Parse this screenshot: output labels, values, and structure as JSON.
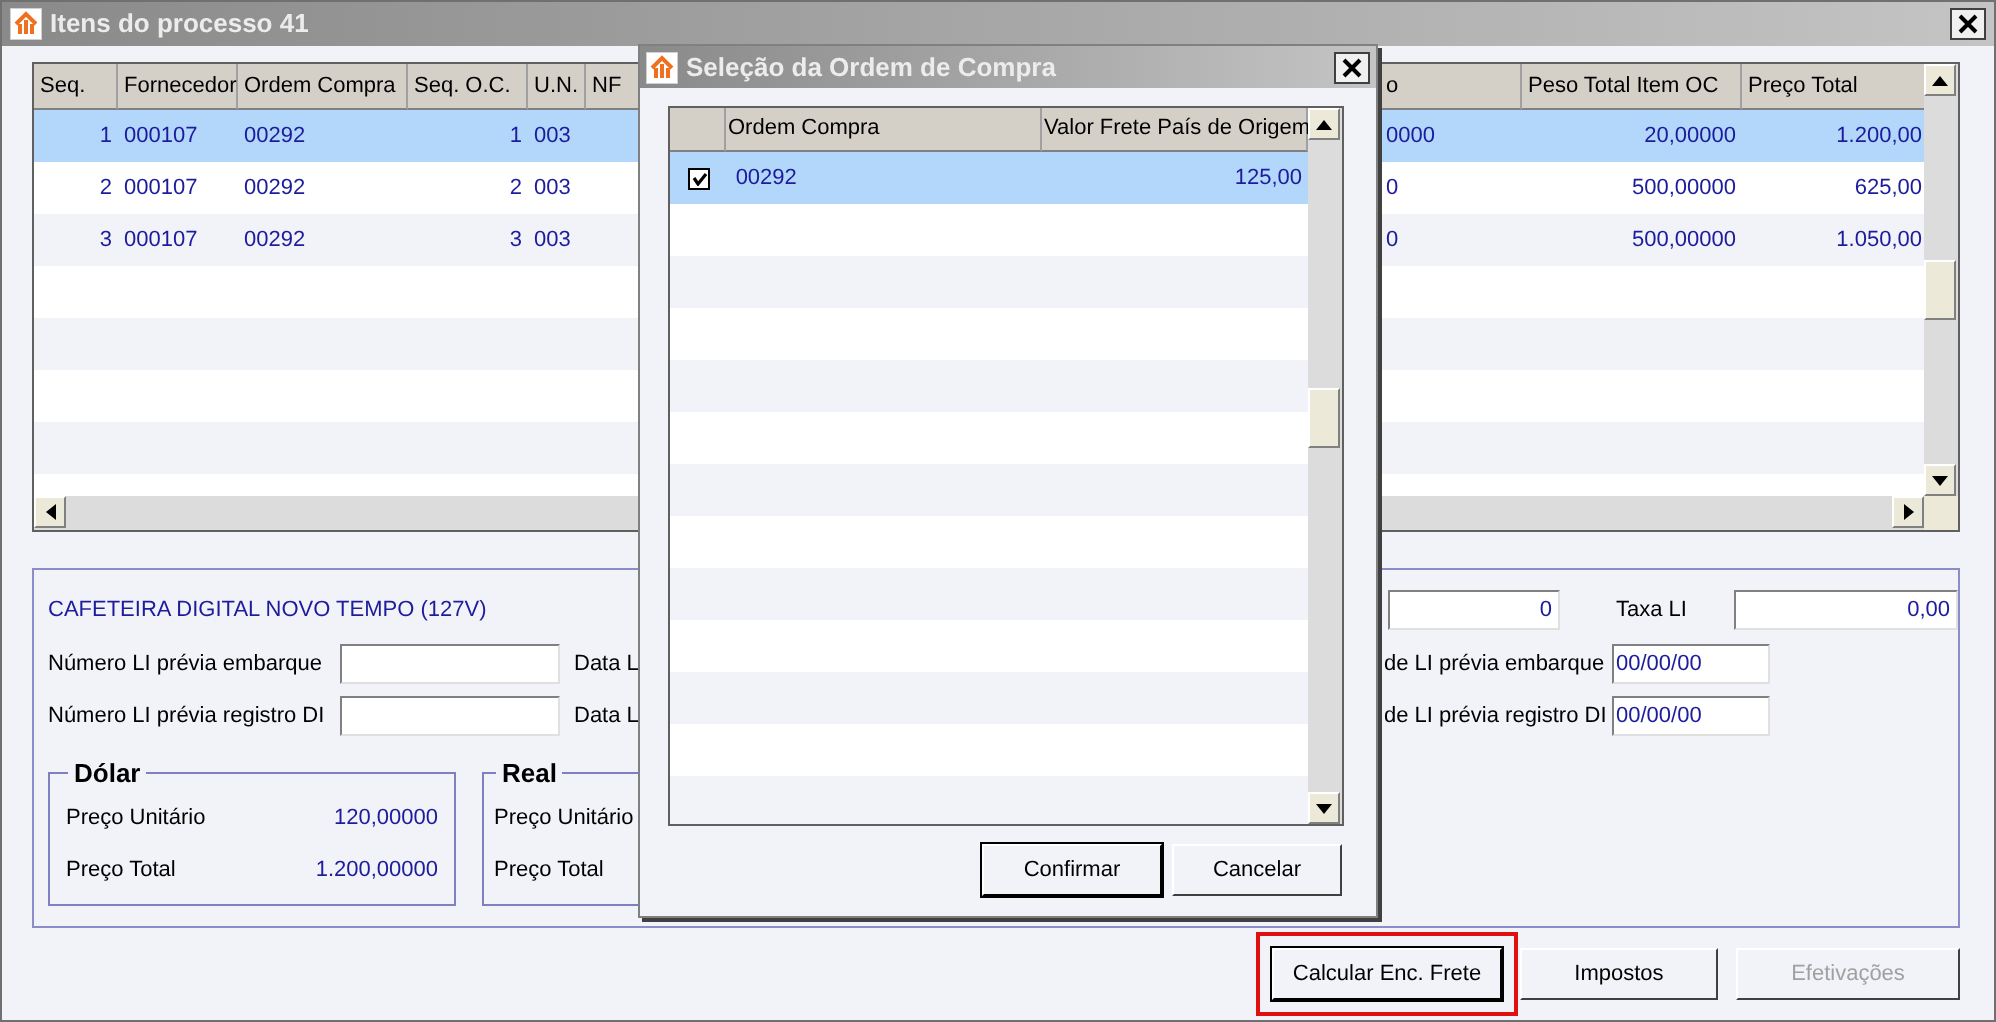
{
  "main_window": {
    "title": "Itens do processo 41",
    "table": {
      "columns_left": [
        "Seq.",
        "Fornecedor",
        "Ordem Compra",
        "Seq. O.C.",
        "U.N.",
        "NF"
      ],
      "columns_right": [
        "o",
        "Peso Total Item OC",
        "Preço Total"
      ],
      "rows": [
        {
          "selected": true,
          "left_cells": [
            "1",
            "000107",
            "00292",
            "1",
            "003"
          ],
          "right_cells": [
            "0000",
            "20,00000",
            "1.200,00"
          ]
        },
        {
          "selected": false,
          "left_cells": [
            "2",
            "000107",
            "00292",
            "2",
            "003"
          ],
          "right_cells": [
            "0",
            "500,00000",
            "625,00"
          ]
        },
        {
          "selected": false,
          "left_cells": [
            "3",
            "000107",
            "00292",
            "3",
            "003"
          ],
          "right_cells": [
            "0",
            "500,00000",
            "1.050,00"
          ]
        }
      ]
    },
    "details": {
      "product_title": "CAFETEIRA DIGITAL NOVO TEMPO (127V)",
      "left_fields": [
        {
          "label": "Número LI prévia embarque",
          "next_label": "Data L"
        },
        {
          "label": "Número LI prévia registro DI",
          "next_label": "Data L"
        }
      ],
      "groups": [
        {
          "title": "Dólar",
          "rows": [
            {
              "label": "Preço Unitário",
              "value": "120,00000"
            },
            {
              "label": "Preço Total",
              "value": "1.200,00000"
            }
          ]
        },
        {
          "title": "Real",
          "rows": [
            {
              "label": "Preço Unitário"
            },
            {
              "label": "Preço Total"
            }
          ]
        }
      ],
      "top_field": {
        "value": "0"
      },
      "taxa": {
        "label": "Taxa LI",
        "value": "0,00"
      },
      "date_fields": [
        {
          "label": "de LI prévia embarque",
          "value": "00/00/00"
        },
        {
          "label": "de LI prévia registro DI",
          "value": "00/00/00"
        }
      ]
    },
    "buttons": [
      {
        "label": "Calcular Enc. Frete",
        "focused": true,
        "disabled": false,
        "highlighted": true
      },
      {
        "label": "Impostos",
        "focused": false,
        "disabled": false,
        "highlighted": false
      },
      {
        "label": "Efetivações",
        "focused": false,
        "disabled": true,
        "highlighted": false
      }
    ]
  },
  "dialog": {
    "title": "Seleção da Ordem de Compra",
    "columns": [
      "Ordem Compra",
      "Valor Frete País de Origem"
    ],
    "rows": [
      {
        "selected": true,
        "checked": true,
        "cells": [
          "00292",
          "125,00"
        ]
      }
    ],
    "buttons": [
      {
        "label": "Confirmar",
        "default": true
      },
      {
        "label": "Cancelar",
        "default": false
      }
    ]
  }
}
